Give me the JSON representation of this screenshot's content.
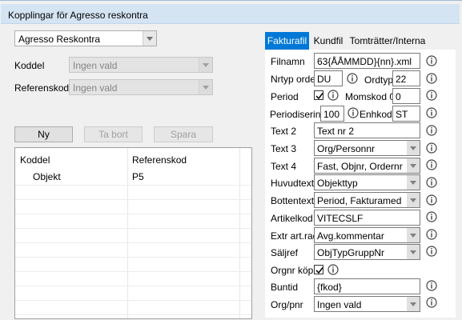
{
  "window": {
    "title": "Kopplingar för Agresso reskontra"
  },
  "left": {
    "system_select": "Agresso Reskontra",
    "koddel_label": "Koddel",
    "koddel_value": "Ingen vald",
    "referenskod_label": "Referenskod",
    "referenskod_value": "Ingen vald",
    "buttons": {
      "new": "Ny",
      "delete": "Ta bort",
      "save": "Spara"
    },
    "grid": {
      "columns": [
        "Koddel",
        "Referenskod"
      ],
      "rows": [
        {
          "koddel": "Objekt",
          "referenskod": "P5"
        }
      ]
    }
  },
  "tabs": [
    "Fakturafil",
    "Kundfil",
    "Tomträtter/Interna"
  ],
  "form": {
    "filnamn_label": "Filnamn",
    "filnamn_value": "63{ÅÅMMDD}{nn}.xml",
    "nrtyp_label": "Nrtyp order",
    "nrtyp_value": "DU",
    "ordtyp_label": "Ordtyp",
    "ordtyp_value": "22",
    "period_label": "Period",
    "period_checked": true,
    "momskod_label": "Momskod 0",
    "momskod_value": "0",
    "periodisering_label": "Periodisering",
    "periodisering_value": "100",
    "enhkod_label": "Enhkod",
    "enhkod_value": "ST",
    "text2_label": "Text 2",
    "text2_value": "Text nr 2",
    "text3_label": "Text 3",
    "text3_value": "Org/Personnr",
    "text4_label": "Text 4",
    "text4_value": "Fast, Objnr, Ordernr",
    "huvudtext_label": "Huvudtext",
    "huvudtext_value": "Objekttyp",
    "bottentext_label": "Bottentext",
    "bottentext_value": "Period, Fakturamed",
    "artikelkod_label": "Artikelkod",
    "artikelkod_value": "VITECSLF",
    "extr_label": "Extr art.rad",
    "extr_value": "Avg.kommentar",
    "saljref_label": "Säljref",
    "saljref_value": "ObjTypGruppNr",
    "orgnr_label": "Orgnr köp",
    "orgnr_checked": true,
    "buntid_label": "Buntid",
    "buntid_value": "{fkod}",
    "orgpnr_label": "Org/pnr",
    "orgpnr_value": "Ingen vald"
  },
  "colors": {
    "tab_active": "#0078d7",
    "title_bg": "#d5e4f3",
    "info_icon": "#404040"
  },
  "icons": {
    "info": "info-icon",
    "dropdown": "chevron-down-icon",
    "checkbox": "checkmark-icon"
  }
}
